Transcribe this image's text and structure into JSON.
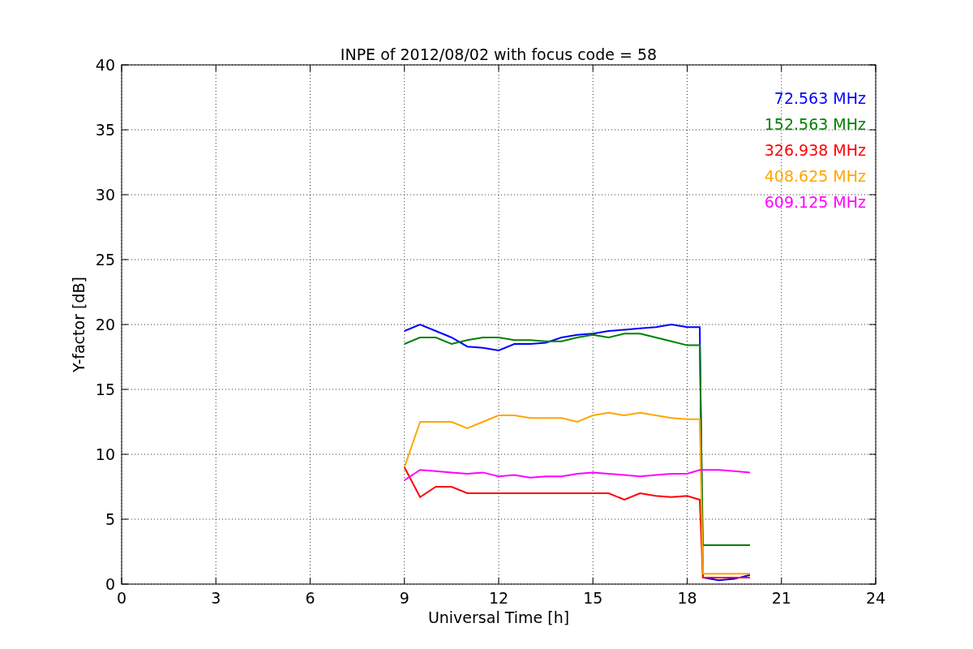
{
  "chart_data": {
    "type": "line",
    "title": "INPE of 2012/08/02 with focus code = 58",
    "xlabel": "Universal Time [h]",
    "ylabel": "Y-factor [dB]",
    "x": [
      9,
      9.5,
      10,
      10.5,
      11,
      11.5,
      12,
      12.5,
      13,
      13.5,
      14,
      14.5,
      15,
      15.5,
      16,
      16.5,
      17,
      17.5,
      18,
      18.4,
      18.5,
      19,
      19.5,
      20
    ],
    "series": [
      {
        "name": "72.563 MHz",
        "color": "#0000ff",
        "values": [
          19.5,
          20,
          19.5,
          19,
          18.3,
          18.2,
          18,
          18.5,
          18.5,
          18.6,
          19,
          19.2,
          19.3,
          19.5,
          19.6,
          19.7,
          19.8,
          20,
          19.8,
          19.8,
          0.5,
          0.3,
          0.4,
          0.7
        ]
      },
      {
        "name": "152.563 MHz",
        "color": "#008000",
        "values": [
          18.5,
          19,
          19,
          18.5,
          18.8,
          19,
          19,
          18.8,
          18.8,
          18.7,
          18.7,
          19,
          19.2,
          19,
          19.3,
          19.3,
          19,
          18.7,
          18.4,
          18.4,
          3,
          3,
          3,
          3
        ]
      },
      {
        "name": "326.938 MHz",
        "color": "#ff0000",
        "values": [
          9,
          6.7,
          7.5,
          7.5,
          7,
          7,
          7,
          7,
          7,
          7,
          7,
          7,
          7,
          7,
          6.5,
          7,
          6.8,
          6.7,
          6.8,
          6.5,
          0.5,
          0.5,
          0.5,
          0.5
        ]
      },
      {
        "name": "408.625 MHz",
        "color": "#ffa500",
        "values": [
          9,
          12.5,
          12.5,
          12.5,
          12,
          12.5,
          13,
          13,
          12.8,
          12.8,
          12.8,
          12.5,
          13,
          13.2,
          13,
          13.2,
          13,
          12.8,
          12.7,
          12.7,
          0.8,
          0.8,
          0.8,
          0.8
        ]
      },
      {
        "name": "609.125 MHz",
        "color": "#ff00ff",
        "values": [
          8,
          8.8,
          8.7,
          8.6,
          8.5,
          8.6,
          8.3,
          8.4,
          8.2,
          8.3,
          8.3,
          8.5,
          8.6,
          8.5,
          8.4,
          8.3,
          8.4,
          8.5,
          8.5,
          8.8,
          8.8,
          8.8,
          8.7,
          8.6
        ]
      }
    ],
    "grid": true,
    "xlim": [
      0,
      24
    ],
    "ylim": [
      0,
      40
    ],
    "xticks": [
      0,
      3,
      6,
      9,
      12,
      15,
      18,
      21,
      24
    ],
    "yticks": [
      0,
      5,
      10,
      15,
      20,
      25,
      30,
      35,
      40
    ]
  }
}
